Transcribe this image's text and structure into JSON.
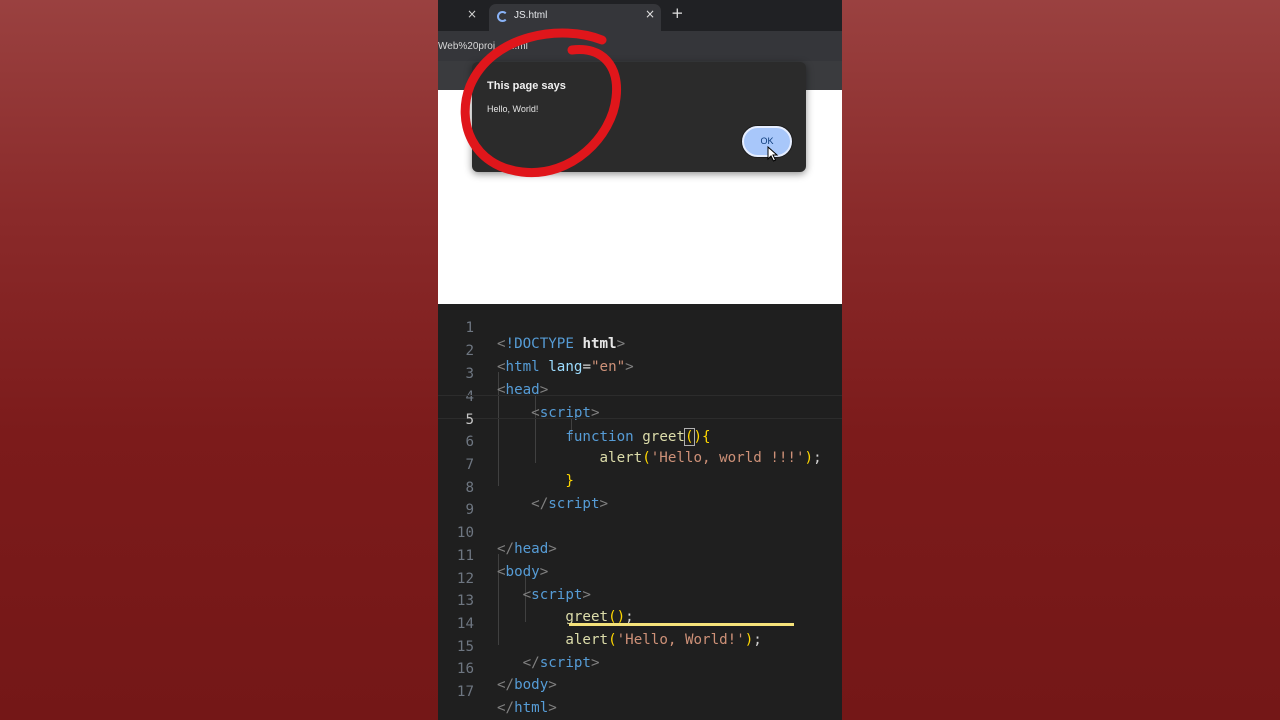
{
  "browser": {
    "active_tab_title": "JS.html",
    "close_glyph": "×",
    "new_tab_glyph": "+",
    "url_fragment": "Web%20proj...o...ml"
  },
  "dialog": {
    "title": "This page says",
    "message": "Hello, World!",
    "ok_label": "OK"
  },
  "annotation": {
    "circle_color": "#e0161b",
    "underline_color": "#f5e27a"
  },
  "editor": {
    "line_numbers": [
      "1",
      "2",
      "3",
      "4",
      "5",
      "6",
      "7",
      "8",
      "9",
      "10",
      "11",
      "12",
      "13",
      "14",
      "15",
      "16",
      "17"
    ],
    "active_line": 5,
    "lines": {
      "l1_doctype": "!DOCTYPE",
      "l1_html": "html",
      "l2_tag": "html",
      "l2_attr": "lang",
      "l2_value": "\"en\"",
      "l3_tag": "head",
      "l4_tag": "script",
      "l5_keyword": "function",
      "l5_name": "greet",
      "l6_call": "alert",
      "l6_string": "'Hello, world !!!'",
      "l8_tag": "script",
      "l10_tag": "head",
      "l11_tag": "body",
      "l12_tag": "script",
      "l13_call": "greet",
      "l14_call": "alert",
      "l14_string": "'Hello, World!'",
      "l15_tag": "script",
      "l16_tag": "body",
      "l17_tag": "html"
    }
  }
}
